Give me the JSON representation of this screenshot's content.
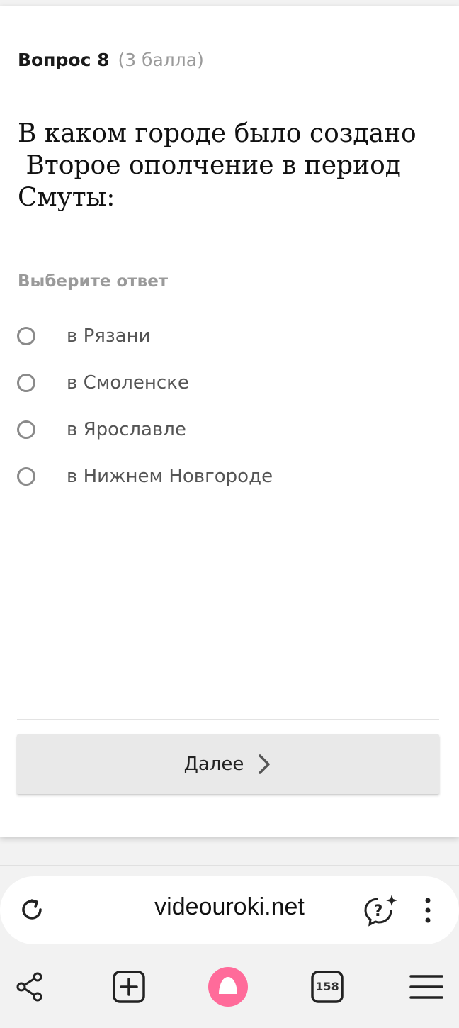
{
  "question": {
    "number_label": "Вопрос 8",
    "points_label": "(3 балла)",
    "text": "В каком городе было создано\n Второе ополчение в период\nСмуты:",
    "choose_label": "Выберите ответ",
    "options": [
      {
        "label": "в Рязани",
        "selected": false
      },
      {
        "label": "в Смоленске",
        "selected": false
      },
      {
        "label": "в Ярославле",
        "selected": false
      },
      {
        "label": "в Нижнем Новгороде",
        "selected": false
      }
    ]
  },
  "next_button": {
    "label": "Далее"
  },
  "browser": {
    "url": "videouroki.net",
    "tabs_count": "158",
    "icons": {
      "reload": "reload-icon",
      "assistant": "assistant-question-icon",
      "more": "more-vert-icon",
      "share": "share-icon",
      "new_tab": "add-box-icon",
      "alice": "alice-icon",
      "tabs": "tabs-icon",
      "menu": "menu-icon"
    },
    "accent_color": "#ff6b9a"
  }
}
